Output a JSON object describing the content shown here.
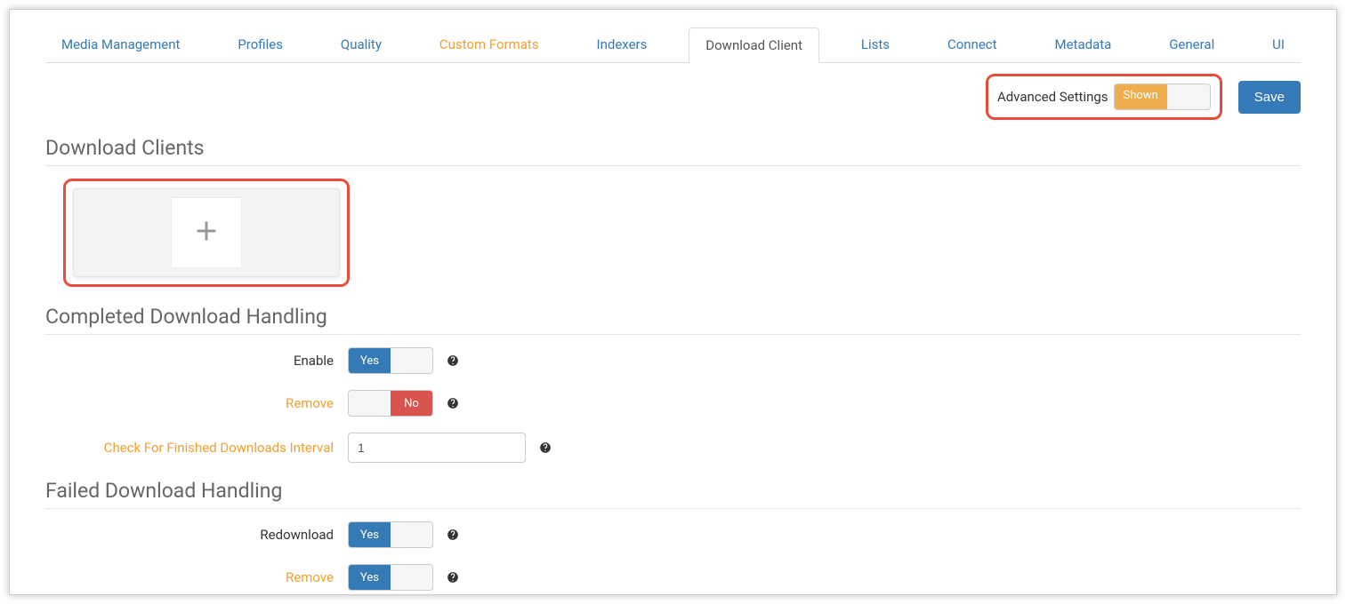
{
  "tabs": {
    "media_management": "Media Management",
    "profiles": "Profiles",
    "quality": "Quality",
    "custom_formats": "Custom Formats",
    "indexers": "Indexers",
    "download_client": "Download Client",
    "lists": "Lists",
    "connect": "Connect",
    "metadata": "Metadata",
    "general": "General",
    "ui": "UI"
  },
  "toolbar": {
    "advanced_label": "Advanced Settings",
    "advanced_state": "Shown",
    "save_label": "Save"
  },
  "sections": {
    "download_clients": "Download Clients",
    "completed_handling": "Completed Download Handling",
    "failed_handling": "Failed Download Handling"
  },
  "completed": {
    "enable_label": "Enable",
    "enable_value": "Yes",
    "remove_label": "Remove",
    "remove_value": "No",
    "interval_label": "Check For Finished Downloads Interval",
    "interval_value": "1"
  },
  "failed": {
    "redownload_label": "Redownload",
    "redownload_value": "Yes",
    "remove_label": "Remove",
    "remove_value": "Yes"
  }
}
